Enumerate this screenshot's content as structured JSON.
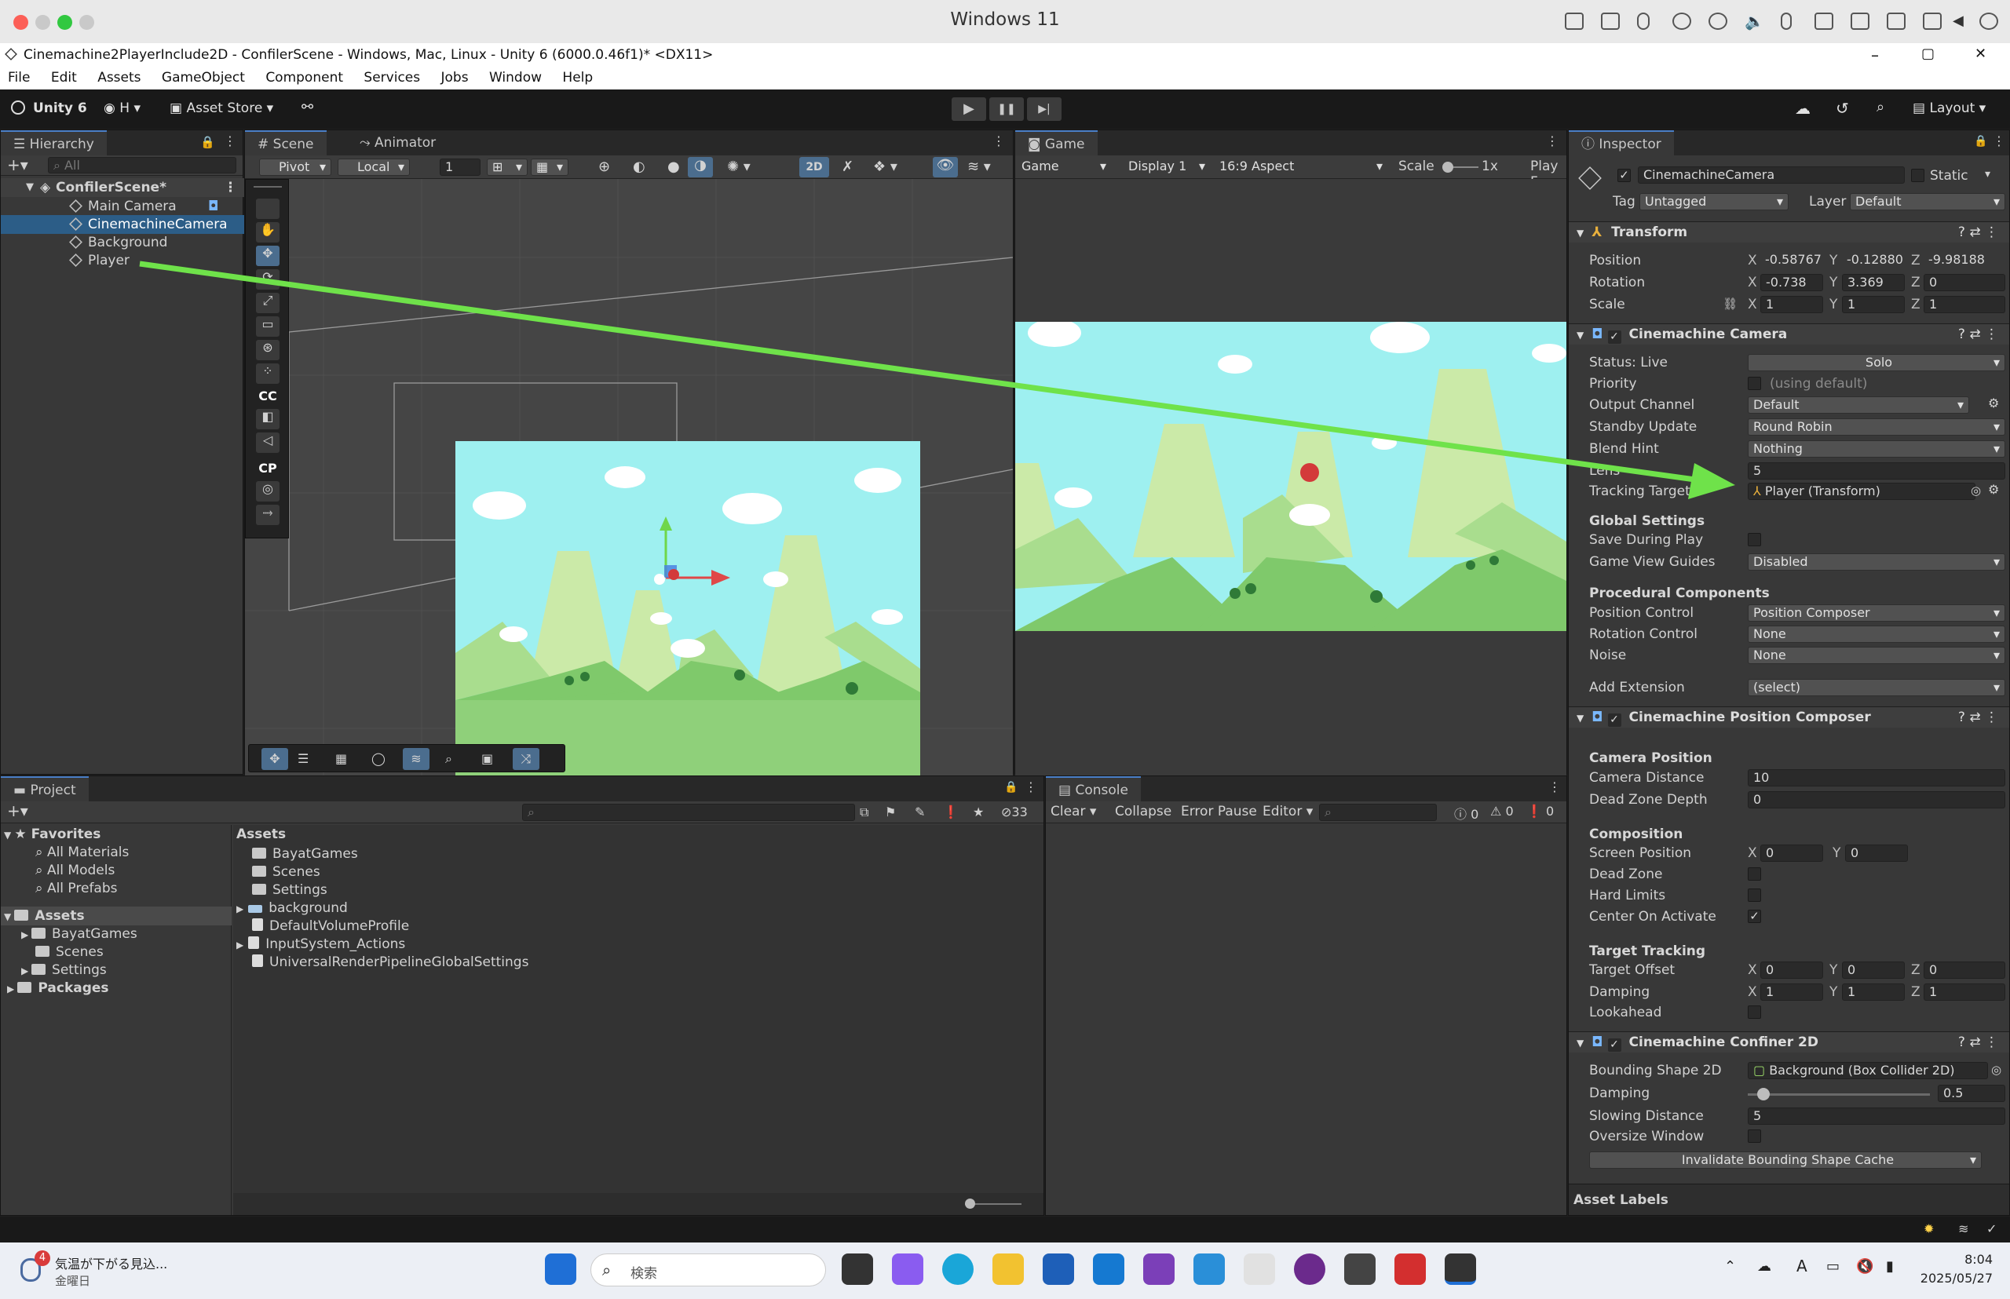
{
  "mac": {
    "title": "Windows 11"
  },
  "window": {
    "title": "Cinemachine2PlayerInclude2D - ConfilerScene - Windows, Mac, Linux - Unity 6 (6000.0.46f1)* <DX11>",
    "min": "–",
    "max": "▢",
    "close": "✕"
  },
  "menu": [
    "File",
    "Edit",
    "Assets",
    "GameObject",
    "Component",
    "Services",
    "Jobs",
    "Window",
    "Help"
  ],
  "toolbar": {
    "unity": "Unity 6",
    "account": "H",
    "store": "Asset Store",
    "layout": "Layout",
    "play": "▶",
    "pause": "❚❚",
    "step": "▶|"
  },
  "hierarchy": {
    "tab": "Hierarchy",
    "search": "All",
    "scene": "ConfilerScene*",
    "items": [
      "Main Camera",
      "CinemachineCamera",
      "Background",
      "Player"
    ]
  },
  "scene": {
    "tab": "Scene",
    "animator": "Animator",
    "pivot": "Pivot",
    "local": "Local",
    "snap": "1",
    "mode2d": "2D",
    "cc": "CC",
    "cp": "CP"
  },
  "game": {
    "tab": "Game",
    "mode": "Game",
    "display": "Display 1",
    "aspect": "16:9 Aspect",
    "scale": "Scale",
    "scale_val": "1x",
    "play": "Play F"
  },
  "inspector": {
    "tab": "Inspector",
    "name": "CinemachineCamera",
    "static": "Static",
    "tag_label": "Tag",
    "tag": "Untagged",
    "layer_label": "Layer",
    "layer": "Default",
    "transform": {
      "title": "Transform",
      "position": "Position",
      "rotation": "Rotation",
      "scale": "Scale",
      "px": "-0.58767",
      "py": "-0.12880",
      "pz": "-9.98188",
      "rx": "-0.738",
      "ry": "3.369",
      "rz": "0",
      "sx": "1",
      "sy": "1",
      "sz": "1"
    },
    "cam": {
      "title": "Cinemachine Camera",
      "status": "Status: Live",
      "solo": "Solo",
      "priority": "Priority",
      "using_default": "(using default)",
      "output": "Output Channel",
      "output_val": "Default",
      "standby": "Standby Update",
      "standby_val": "Round Robin",
      "blend": "Blend Hint",
      "blend_val": "Nothing",
      "lens": "Lens",
      "lens_val": "5",
      "target": "Tracking Target",
      "target_val": "Player (Transform)",
      "global": "Global Settings",
      "save": "Save During Play",
      "guides": "Game View Guides",
      "guides_val": "Disabled",
      "proc": "Procedural Components",
      "posctl": "Position Control",
      "posctl_val": "Position Composer",
      "rotctl": "Rotation Control",
      "rotctl_val": "None",
      "noise": "Noise",
      "noise_val": "None",
      "ext": "Add Extension",
      "ext_val": "(select)"
    },
    "composer": {
      "title": "Cinemachine Position Composer",
      "campos": "Camera Position",
      "dist": "Camera Distance",
      "dist_val": "10",
      "dz": "Dead Zone Depth",
      "dz_val": "0",
      "comp": "Composition",
      "sp": "Screen Position",
      "spx": "0",
      "spy": "0",
      "dead": "Dead Zone",
      "hard": "Hard Limits",
      "center": "Center On Activate",
      "tt": "Target Tracking",
      "to": "Target Offset",
      "tox": "0",
      "toy": "0",
      "toz": "0",
      "damp": "Damping",
      "dx": "1",
      "dy": "1",
      "dz2": "1",
      "look": "Lookahead"
    },
    "confiner": {
      "title": "Cinemachine Confiner 2D",
      "bs": "Bounding Shape 2D",
      "bs_val": "Background (Box Collider 2D)",
      "damp": "Damping",
      "damp_val": "0.5",
      "damp_fraction": 0.05,
      "slow": "Slowing Distance",
      "slow_val": "5",
      "over": "Oversize Window",
      "btn": "Invalidate Bounding Shape Cache"
    },
    "labels": "Asset Labels"
  },
  "project": {
    "tab": "Project",
    "favorites": "Favorites",
    "fav": [
      "All Materials",
      "All Models",
      "All Prefabs"
    ],
    "assets": "Assets",
    "tree": [
      "BayatGames",
      "Scenes",
      "Settings"
    ],
    "packages": "Packages",
    "header": "Assets",
    "files": [
      "BayatGames",
      "Scenes",
      "Settings",
      "background",
      "DefaultVolumeProfile",
      "InputSystem_Actions",
      "UniversalRenderPipelineGlobalSettings"
    ],
    "hidden": "33"
  },
  "console": {
    "tab": "Console",
    "clear": "Clear",
    "collapse": "Collapse",
    "errpause": "Error Pause",
    "editor": "Editor",
    "c0": "0",
    "c1": "0",
    "c2": "0"
  },
  "taskbar": {
    "weather": "気温が下がる見込...",
    "weather_sub": "金曜日",
    "badge": "4",
    "search": "検索",
    "time": "8:04",
    "date": "2025/05/27",
    "ime": "A"
  },
  "colors": {
    "accent": "#2c5d87",
    "arrow": "#6fe24a",
    "sky": "#9ef0f0",
    "ground": "#8fd07a"
  }
}
